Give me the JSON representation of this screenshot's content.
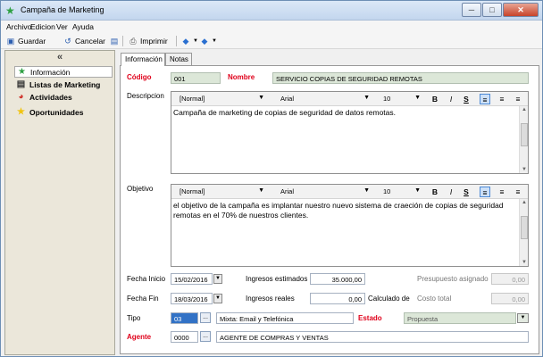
{
  "window": {
    "title": "Campaña de Marketing",
    "controls": {
      "minimize": "─",
      "maximize": "□",
      "close": "✕"
    }
  },
  "menu": [
    "Archivo",
    "Edicion",
    "Ver",
    "Ayuda"
  ],
  "toolbar": {
    "save": "Guardar",
    "cancel": "Cancelar",
    "print": "Imprimir"
  },
  "sidebar": {
    "collapse": "«",
    "items": [
      {
        "label": "Información",
        "icon": "star-icon",
        "color": "#2ea043"
      },
      {
        "label": "Listas de Marketing",
        "icon": "document-list-icon",
        "color": "#333333"
      },
      {
        "label": "Actividades",
        "icon": "pie-chart-icon",
        "color": "#d0342c"
      },
      {
        "label": "Oportunidades",
        "icon": "star-icon",
        "color": "#f1c40f"
      }
    ]
  },
  "tabs": [
    "Información",
    "Notas"
  ],
  "form": {
    "codigo_label": "Código",
    "codigo": "001",
    "nombre_label": "Nombre",
    "nombre": "SERVICIO COPIAS DE SEGURIDAD REMOTAS",
    "descripcion_label": "Descripcion",
    "objetivo_label": "Objetivo",
    "editor_toolbar": {
      "style": "[Normal]",
      "font": "Arial",
      "size": "10",
      "bold": "B",
      "italic": "I",
      "strike": "S"
    },
    "descripcion": "Campaña de marketing de copias de seguridad de datos remotas.",
    "objetivo": "el objetivo de la campaña es implantar nuestro nuevo sistema de craeción de copias de seguridad remotas en el 70% de nuestros clientes.",
    "fecha_inicio_label": "Fecha Inicio",
    "fecha_inicio": "15/02/2016",
    "fecha_fin_label": "Fecha Fin",
    "fecha_fin": "18/03/2016",
    "ingresos_estimados_label": "Ingresos estimados",
    "ingresos_estimados": "35.000,00",
    "ingresos_reales_label": "Ingresos reales",
    "ingresos_reales": "0,00",
    "calculado_de_label": "Calculado de",
    "presupuesto_asignado_label": "Presupuesto asignado",
    "presupuesto_asignado": "0,00",
    "costo_total_label": "Costo total",
    "costo_total": "0,00",
    "tipo_label": "Tipo",
    "tipo_codigo": "03",
    "tipo": "Mixta: Email y Telefónica",
    "estado_label": "Estado",
    "estado": "Propuesta",
    "agente_label": "Agente",
    "agente_codigo": "0000",
    "agente": "AGENTE DE COMPRAS Y VENTAS",
    "ellipsis": "...",
    "dropdown_arrow": "▼"
  }
}
